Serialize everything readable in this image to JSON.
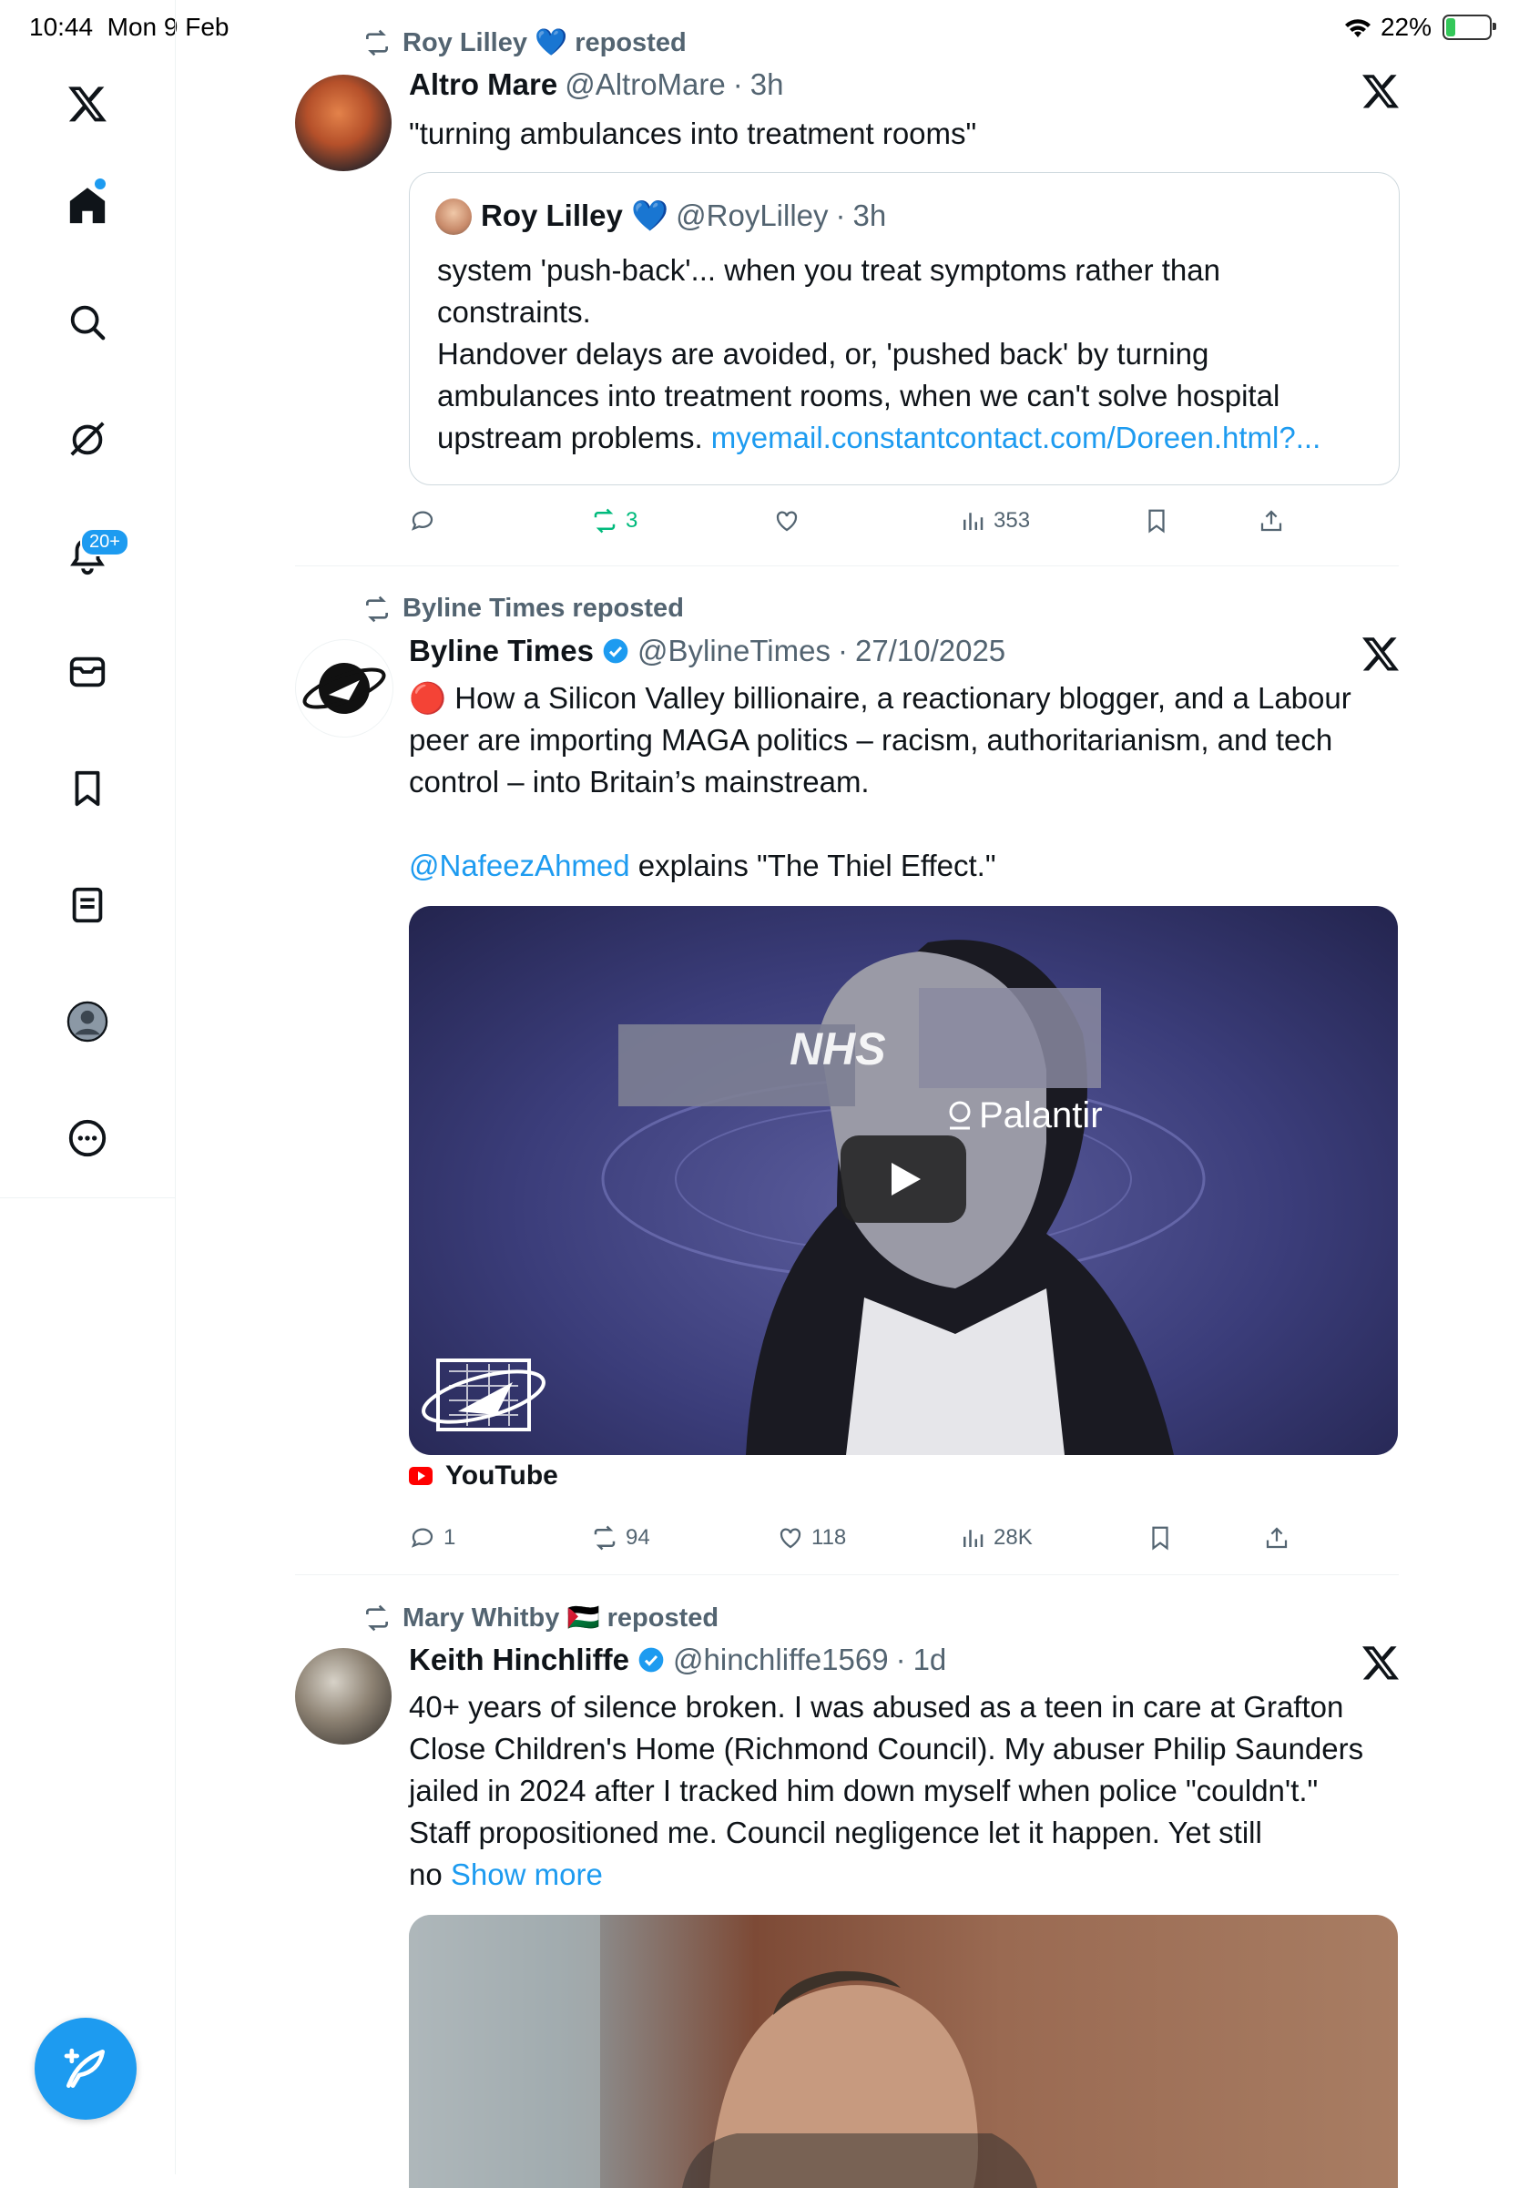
{
  "status_bar": {
    "time": "10:44",
    "date": "Mon 9 Feb",
    "battery": "22%",
    "battery_level": 0.22
  },
  "sidebar": {
    "items": [
      {
        "name": "x-logo-icon"
      },
      {
        "name": "home-icon"
      },
      {
        "name": "search-icon"
      },
      {
        "name": "grok-icon"
      },
      {
        "name": "notifications-icon"
      },
      {
        "name": "messages-icon"
      },
      {
        "name": "bookmarks-icon"
      },
      {
        "name": "lists-icon"
      },
      {
        "name": "profile-icon"
      },
      {
        "name": "more-icon"
      }
    ],
    "notifications_badge": "20+"
  },
  "feed": {
    "posts": [
      {
        "repost_by": "Roy Lilley 💙 reposted",
        "name": "Altro Mare",
        "handle": "@AltroMare",
        "sep": "·",
        "time": "3h",
        "text": "\"turning ambulances into treatment rooms\"",
        "quote": {
          "name": "Roy Lilley 💙",
          "handle": "@RoyLilley",
          "sep": "·",
          "time": "3h",
          "line1": "system 'push-back'... when you treat symptoms rather than",
          "line2": "constraints.",
          "line3": "Handover delays are avoided, or, 'pushed back' by turning",
          "line4": "ambulances into treatment rooms, when we can't solve hospital",
          "line5": "upstream problems.",
          "link": "myemail.constantcontact.com/Doreen.html?..."
        },
        "stats": {
          "replies": "",
          "reposts": "3",
          "likes": "",
          "views": "353"
        }
      },
      {
        "repost_by": "Byline Times reposted",
        "name": "Byline Times",
        "handle": "@BylineTimes",
        "sep": "·",
        "time": "27/10/2025",
        "line1": "🔴 How a Silicon Valley billionaire, a reactionary blogger, and a Labour",
        "line2": "peer are importing MAGA politics – racism, authoritarianism, and tech",
        "line3": "control – into Britain’s mainstream.",
        "mention": "@NafeezAhmed",
        "mention_rest": " explains \"The Thiel Effect.\"",
        "video_text_nhs": "NHS",
        "video_text_palantir": "Palantir",
        "source": "YouTube",
        "stats": {
          "replies": "1",
          "reposts": "94",
          "likes": "118",
          "views": "28K"
        }
      },
      {
        "repost_by": "Mary Whitby 🇵🇸 reposted",
        "name": "Keith Hinchliffe",
        "handle": "@hinchliffe1569",
        "sep": "·",
        "time": "1d",
        "line1": "40+ years of silence broken. I was abused as a teen in care at Grafton",
        "line2": "Close Children's Home (Richmond Council). My abuser Philip Saunders",
        "line3": "jailed in 2024 after I tracked him down myself when police \"couldn't.\"",
        "line4": "Staff propositioned me. Council negligence let it happen. Yet still",
        "line5": "no",
        "show_more": "Show more"
      }
    ]
  },
  "colors": {
    "accent": "#1d9bf0",
    "repost_green": "#00ba7c",
    "muted": "#536471"
  }
}
